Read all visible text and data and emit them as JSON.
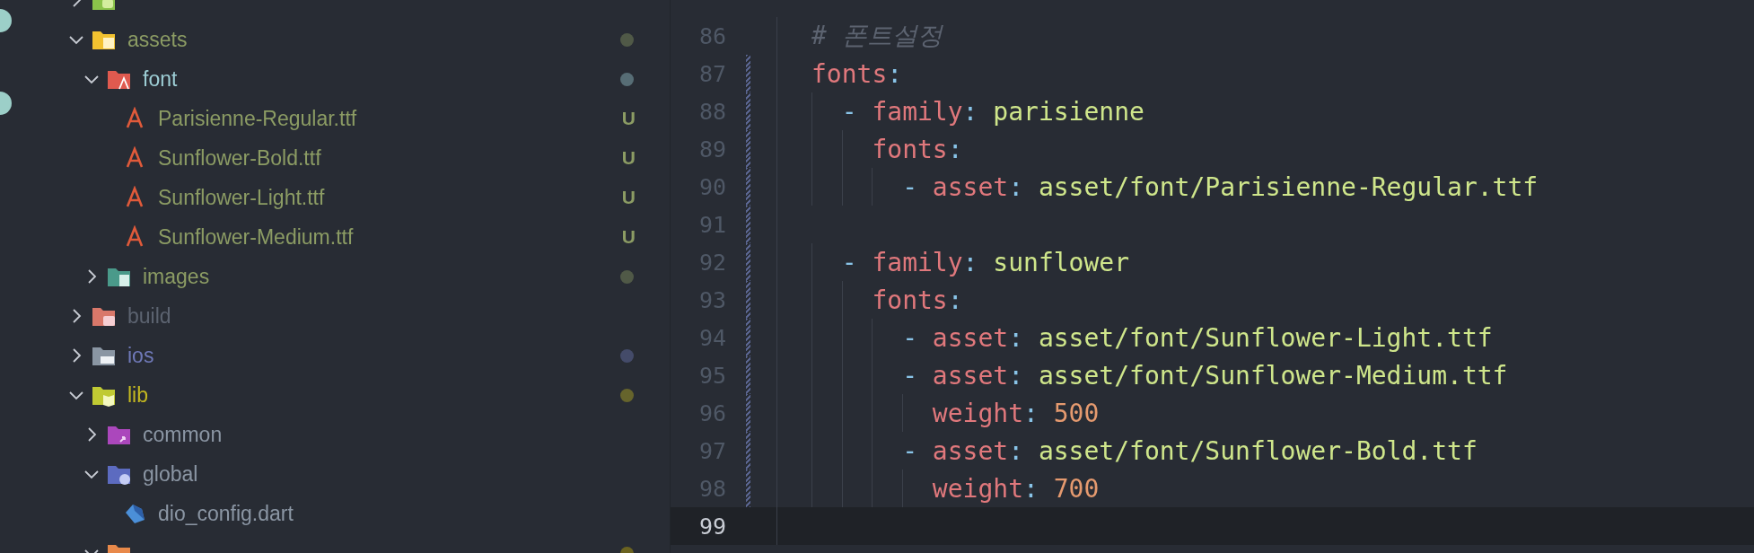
{
  "explorer": {
    "items": [
      {
        "kind": "android",
        "expanded": false
      },
      {
        "name": "assets",
        "kind": "assets",
        "expanded": true,
        "color": "#8c9c64",
        "dot": true,
        "children": [
          {
            "name": "font",
            "kind": "typefaces",
            "expanded": true,
            "color": "#9ecfd6",
            "dot": true,
            "children": [
              {
                "name": "Parisienne-Regular.ttf",
                "kind": "typeface",
                "color": "#8c9c64",
                "badge": "U"
              },
              {
                "name": "Sunflower-Bold.ttf",
                "kind": "typeface",
                "color": "#8c9c64",
                "badge": "U"
              },
              {
                "name": "Sunflower-Light.ttf",
                "kind": "typeface",
                "color": "#8c9c64",
                "badge": "U"
              },
              {
                "name": "Sunflower-Medium.ttf",
                "kind": "typeface",
                "color": "#8c9c64",
                "badge": "U"
              }
            ]
          },
          {
            "name": "images",
            "kind": "images",
            "expanded": false,
            "color": "#8c9c64",
            "dot": true
          }
        ]
      },
      {
        "name": "build",
        "kind": "build",
        "expanded": false,
        "color": "#5c6370"
      },
      {
        "name": "ios",
        "kind": "ios",
        "expanded": false,
        "color": "#6f79b8",
        "dot": true
      },
      {
        "name": "lib",
        "kind": "lib",
        "expanded": true,
        "color": "#c4b820",
        "dot": true,
        "children": [
          {
            "name": "common",
            "kind": "common",
            "expanded": false
          },
          {
            "name": "global",
            "kind": "global",
            "expanded": true,
            "children": [
              {
                "name": "dio_config.dart",
                "kind": "dart"
              }
            ]
          },
          {
            "kind": "pages",
            "expanded": true,
            "color": "#6b6320",
            "dot": true
          }
        ]
      }
    ]
  },
  "editor": {
    "lines": [
      {
        "number": "86",
        "changed": false,
        "current": false,
        "tokens": [
          {
            "kind": "comment",
            "text": "# 폰트설정"
          }
        ]
      },
      {
        "number": "87",
        "changed": true,
        "current": false,
        "tokens": [
          {
            "kind": "key",
            "text": "fonts"
          },
          {
            "kind": "punct",
            "text": ":"
          }
        ]
      },
      {
        "number": "88",
        "changed": true,
        "current": false,
        "tokens": [
          {
            "kind": "dash",
            "text": "  - "
          },
          {
            "kind": "key",
            "text": "family"
          },
          {
            "kind": "punct",
            "text": ": "
          },
          {
            "kind": "string",
            "text": "parisienne"
          }
        ]
      },
      {
        "number": "89",
        "changed": true,
        "current": false,
        "tokens": [
          {
            "kind": "key",
            "text": "    fonts"
          },
          {
            "kind": "punct",
            "text": ":"
          }
        ]
      },
      {
        "number": "90",
        "changed": true,
        "current": false,
        "tokens": [
          {
            "kind": "dash",
            "text": "      - "
          },
          {
            "kind": "key",
            "text": "asset"
          },
          {
            "kind": "punct",
            "text": ": "
          },
          {
            "kind": "string",
            "text": "asset/font/Parisienne-Regular.ttf"
          }
        ]
      },
      {
        "number": "91",
        "changed": true,
        "current": false
      },
      {
        "number": "92",
        "changed": true,
        "current": false,
        "tokens": [
          {
            "kind": "dash",
            "text": "  - "
          },
          {
            "kind": "key",
            "text": "family"
          },
          {
            "kind": "punct",
            "text": ": "
          },
          {
            "kind": "string",
            "text": "sunflower"
          }
        ]
      },
      {
        "number": "93",
        "changed": true,
        "current": false,
        "tokens": [
          {
            "kind": "key",
            "text": "    fonts"
          },
          {
            "kind": "punct",
            "text": ":"
          }
        ]
      },
      {
        "number": "94",
        "changed": true,
        "current": false,
        "tokens": [
          {
            "kind": "dash",
            "text": "      - "
          },
          {
            "kind": "key",
            "text": "asset"
          },
          {
            "kind": "punct",
            "text": ": "
          },
          {
            "kind": "string",
            "text": "asset/font/Sunflower-Light.ttf"
          }
        ]
      },
      {
        "number": "95",
        "changed": true,
        "current": false,
        "tokens": [
          {
            "kind": "dash",
            "text": "      - "
          },
          {
            "kind": "key",
            "text": "asset"
          },
          {
            "kind": "punct",
            "text": ": "
          },
          {
            "kind": "string",
            "text": "asset/font/Sunflower-Medium.ttf"
          }
        ]
      },
      {
        "number": "96",
        "changed": true,
        "current": false,
        "tokens": [
          {
            "kind": "key",
            "text": "        weight"
          },
          {
            "kind": "punct",
            "text": ": "
          },
          {
            "kind": "number",
            "text": "500"
          }
        ]
      },
      {
        "number": "97",
        "changed": true,
        "current": false,
        "tokens": [
          {
            "kind": "dash",
            "text": "      - "
          },
          {
            "kind": "key",
            "text": "asset"
          },
          {
            "kind": "punct",
            "text": ": "
          },
          {
            "kind": "string",
            "text": "asset/font/Sunflower-Bold.ttf"
          }
        ]
      },
      {
        "number": "98",
        "changed": true,
        "current": false,
        "tokens": [
          {
            "kind": "key",
            "text": "        weight"
          },
          {
            "kind": "punct",
            "text": ": "
          },
          {
            "kind": "number",
            "text": "700"
          }
        ]
      },
      {
        "number": "99",
        "changed": false,
        "current": true
      }
    ]
  }
}
